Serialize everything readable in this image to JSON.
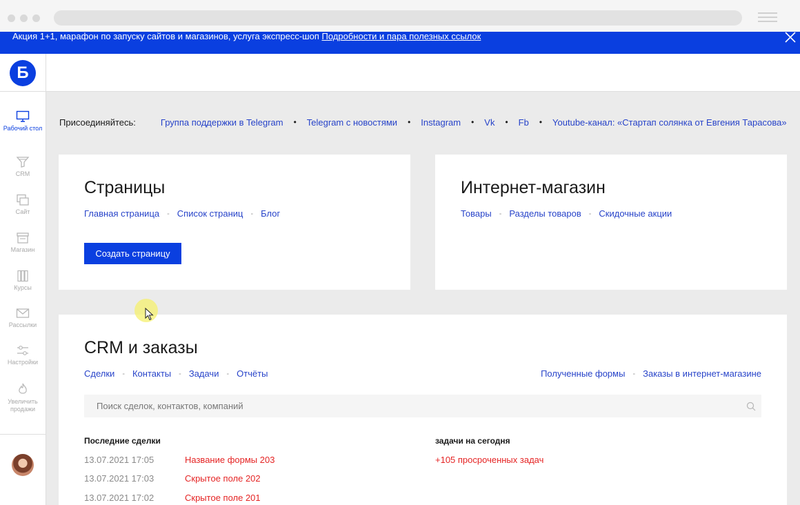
{
  "promo": {
    "text": "Акция 1+1, марафон по запуску сайтов и магазинов, услуга экспресс-шоп",
    "link": "Подробности и пара полезных ссылок"
  },
  "logo": "Б",
  "sidebar": {
    "items": [
      {
        "label": "Рабочий стол",
        "icon": "monitor-icon"
      },
      {
        "label": "CRM",
        "icon": "funnel-icon"
      },
      {
        "label": "Сайт",
        "icon": "windows-icon"
      },
      {
        "label": "Магазин",
        "icon": "store-icon"
      },
      {
        "label": "Курсы",
        "icon": "books-icon"
      },
      {
        "label": "Рассылки",
        "icon": "envelope-icon"
      },
      {
        "label": "Настройки",
        "icon": "sliders-icon"
      },
      {
        "label": "Увеличить продажи",
        "icon": "flame-icon"
      }
    ]
  },
  "social": {
    "join": "Присоединяйтесь:",
    "links": [
      "Группа поддержки в Telegram",
      "Telegram с новостями",
      "Instagram",
      "Vk",
      "Fb",
      "Youtube-канал: «Стартап солянка от Евгения Тарасова»"
    ]
  },
  "pages": {
    "title": "Страницы",
    "links": [
      "Главная страница",
      "Список страниц",
      "Блог"
    ],
    "button": "Создать страницу"
  },
  "shop": {
    "title": "Интернет-магазин",
    "links": [
      "Товары",
      "Разделы товаров",
      "Скидочные акции"
    ]
  },
  "crm": {
    "title": "CRM и заказы",
    "links_left": [
      "Сделки",
      "Контакты",
      "Задачи",
      "Отчёты"
    ],
    "links_right": [
      "Полученные формы",
      "Заказы в интернет-магазине"
    ],
    "search_placeholder": "Поиск сделок, контактов, компаний",
    "deals_header": "Последние сделки",
    "deals": [
      {
        "date": "13.07.2021 17:05",
        "name": "Название формы 203"
      },
      {
        "date": "13.07.2021 17:03",
        "name": "Скрытое поле 202"
      },
      {
        "date": "13.07.2021 17:02",
        "name": "Скрытое поле 201"
      }
    ],
    "tasks_header": "задачи на сегодня",
    "tasks_overdue": "+105 просроченных задач"
  },
  "colors": {
    "accent": "#0a3fe0",
    "link": "#2743c9",
    "alert": "#e52424"
  }
}
